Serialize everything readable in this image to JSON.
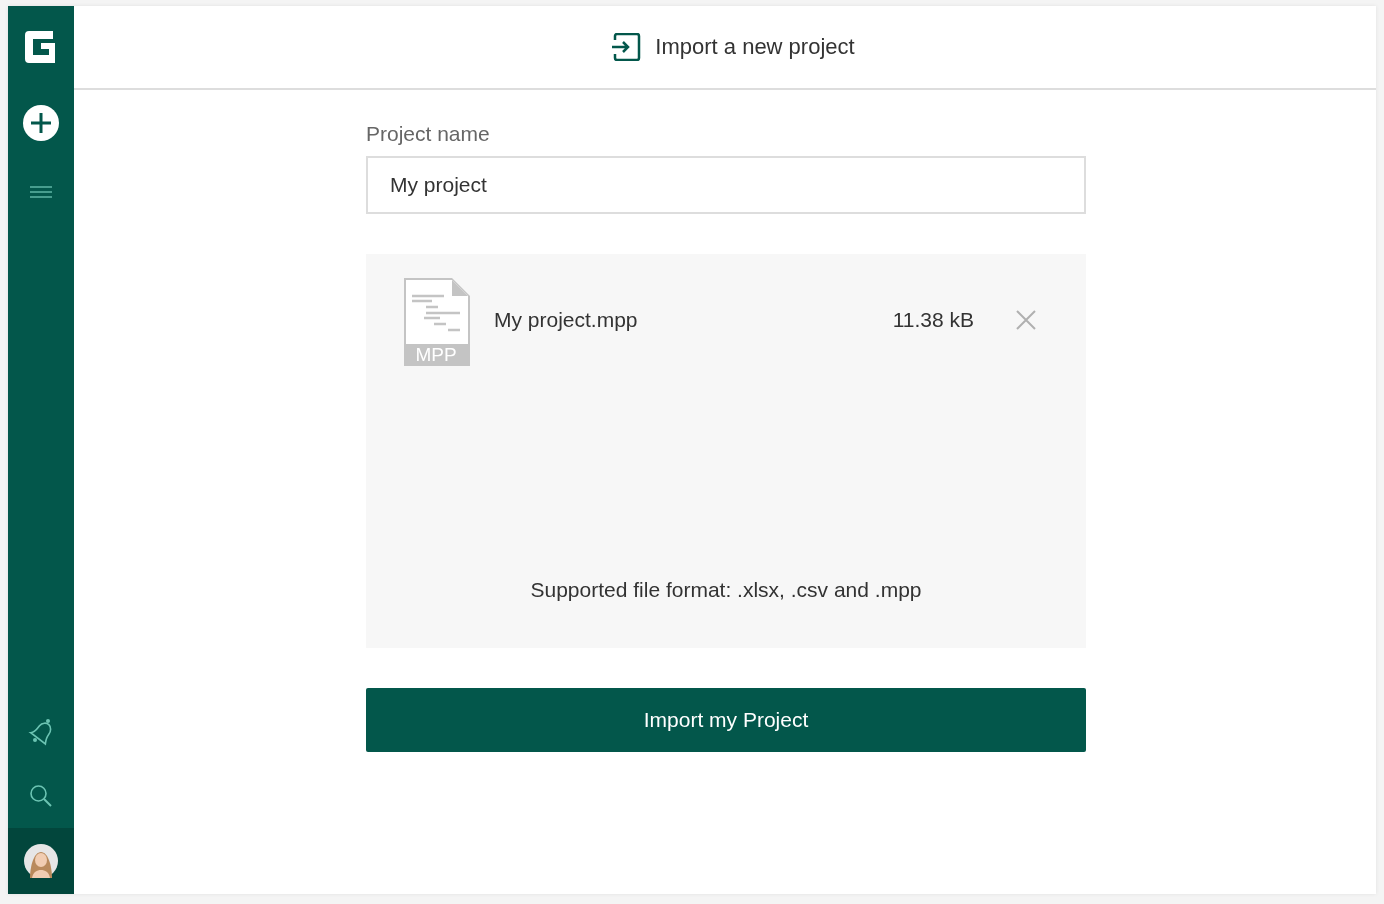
{
  "header": {
    "title": "Import a new project"
  },
  "form": {
    "name_label": "Project name",
    "name_value": "My project"
  },
  "file": {
    "type_label": "MPP",
    "name": "My project.mpp",
    "size": "11.38 kB"
  },
  "dropzone": {
    "hint": "Supported file format: .xlsx, .csv and .mpp"
  },
  "submit": {
    "label": "Import my Project"
  }
}
